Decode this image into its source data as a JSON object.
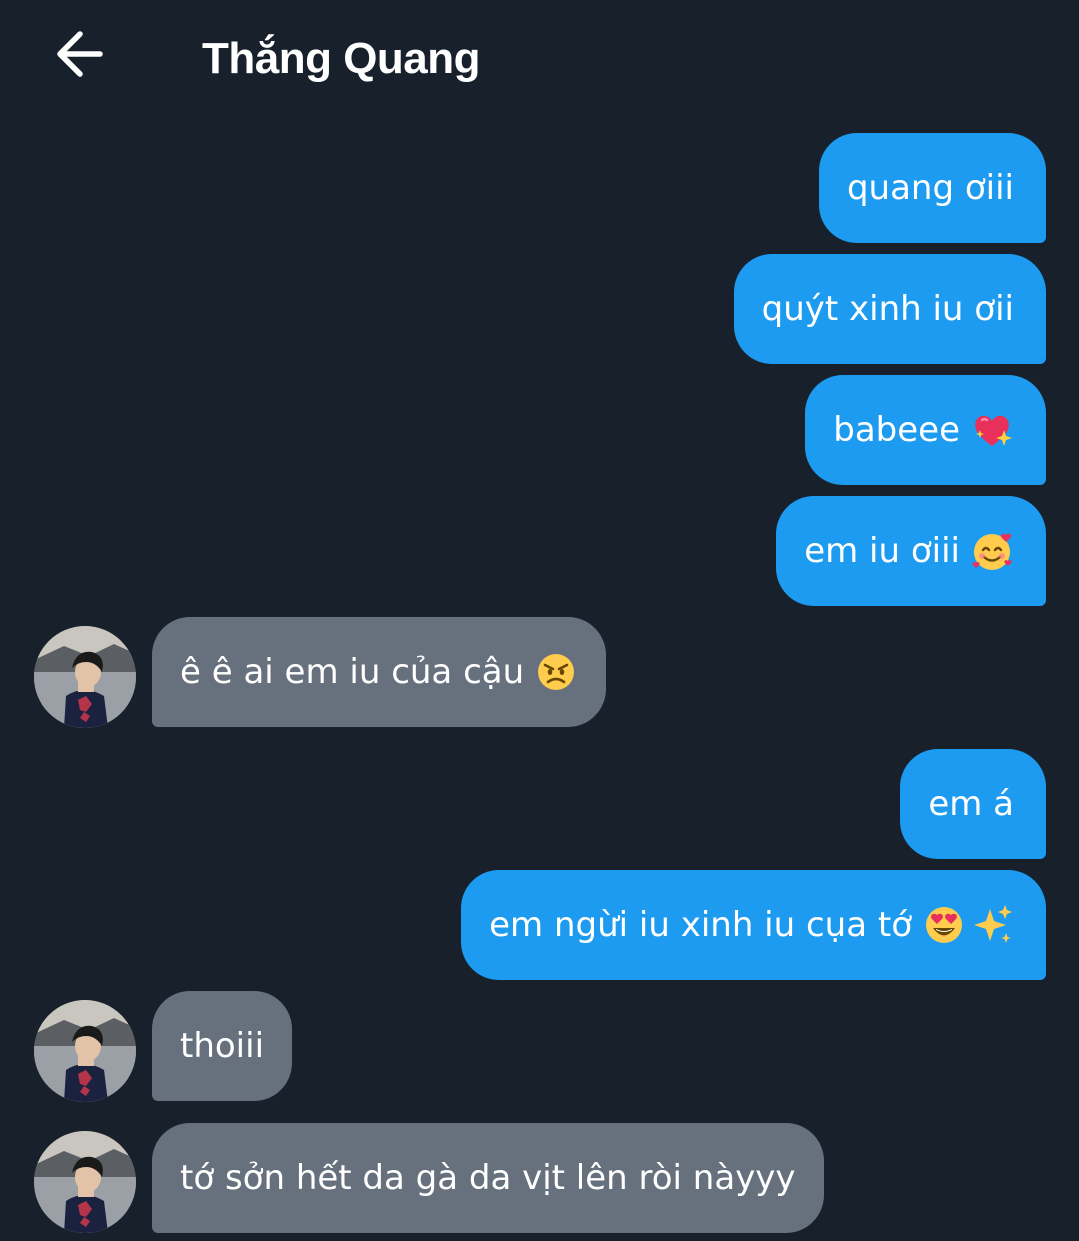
{
  "header": {
    "title": "Thắng Quang",
    "back_icon": "arrow-left-icon"
  },
  "colors": {
    "background": "#17202b",
    "outgoing_bubble": "#1d9bf0",
    "incoming_bubble": "#66717d"
  },
  "messages": [
    {
      "direction": "outgoing",
      "text": "quang ơiii",
      "emoji": []
    },
    {
      "direction": "outgoing",
      "text": "quýt xinh iu ơii",
      "emoji": []
    },
    {
      "direction": "outgoing",
      "text": "babeee",
      "emoji": [
        "sparkling-heart-emoji"
      ]
    },
    {
      "direction": "outgoing",
      "text": "em iu ơiii",
      "emoji": [
        "smiling-face-with-hearts-emoji"
      ]
    },
    {
      "direction": "incoming",
      "text": "ê ê ai em iu của cậu",
      "emoji": [
        "angry-face-emoji"
      ]
    },
    {
      "direction": "outgoing",
      "text": "em á",
      "emoji": []
    },
    {
      "direction": "outgoing",
      "text": "em ngừi iu xinh iu cụa tớ",
      "emoji": [
        "heart-eyes-emoji",
        "sparkles-emoji"
      ]
    },
    {
      "direction": "incoming",
      "text": "thoiii",
      "emoji": []
    },
    {
      "direction": "incoming",
      "text": "tớ sởn hết da gà da vịt lên ròi nàyyy",
      "emoji": []
    }
  ]
}
